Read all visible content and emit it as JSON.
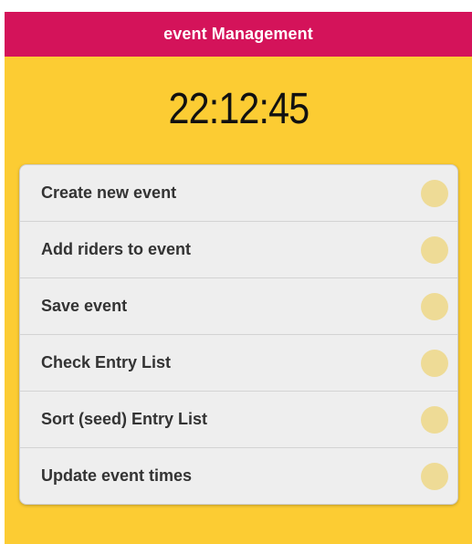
{
  "header": {
    "title": "event Management"
  },
  "clock": {
    "time": "22:12:45"
  },
  "menu": {
    "items": [
      {
        "label": "Create new event"
      },
      {
        "label": "Add riders to event"
      },
      {
        "label": "Save event"
      },
      {
        "label": "Check Entry List"
      },
      {
        "label": "Sort (seed) Entry List"
      },
      {
        "label": "Update event times"
      }
    ]
  },
  "colors": {
    "header_bg": "#d4135a",
    "page_bg": "#fccc33",
    "item_bg": "#eeeeee",
    "indicator": "#eedb96"
  }
}
